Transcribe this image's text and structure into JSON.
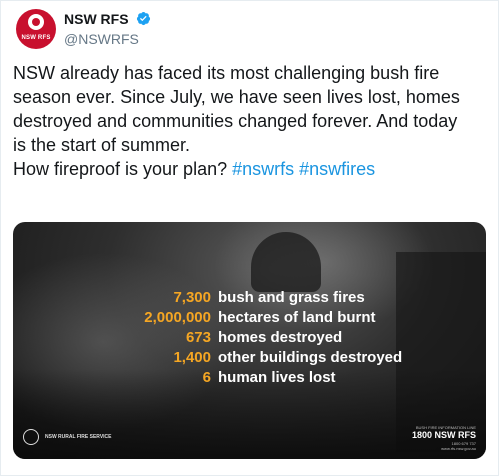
{
  "tweet": {
    "author": {
      "display_name": "NSW RFS",
      "handle": "@NSWRFS",
      "avatar_label": "NSW RFS",
      "verified": true
    },
    "text_lines": [
      "NSW already has faced its most challenging bush fire",
      "season ever. Since July, we have seen lives lost, homes",
      "destroyed and communities changed forever. And today",
      "is the start of summer."
    ],
    "question": "How fireproof is your plan?",
    "hashtags": [
      "#nswrfs",
      "#nswfires"
    ],
    "colors": {
      "link": "#1b95e0",
      "stat_number": "#f5a623",
      "brand_red": "#c8102e"
    }
  },
  "media": {
    "stats": [
      {
        "value": "7,300",
        "label": "bush and grass fires"
      },
      {
        "value": "2,000,000",
        "label": "hectares of land burnt"
      },
      {
        "value": "673",
        "label": "homes destroyed"
      },
      {
        "value": "1,400",
        "label": "other buildings destroyed"
      },
      {
        "value": "6",
        "label": "human lives lost"
      }
    ],
    "footer_left_label": "NSW RURAL FIRE SERVICE",
    "footer_right": {
      "small": "BUSH FIRE INFORMATION LINE",
      "big": "1800 NSW RFS",
      "phone": "1800 679 737",
      "url": "www.rfs.nsw.gov.au"
    }
  }
}
